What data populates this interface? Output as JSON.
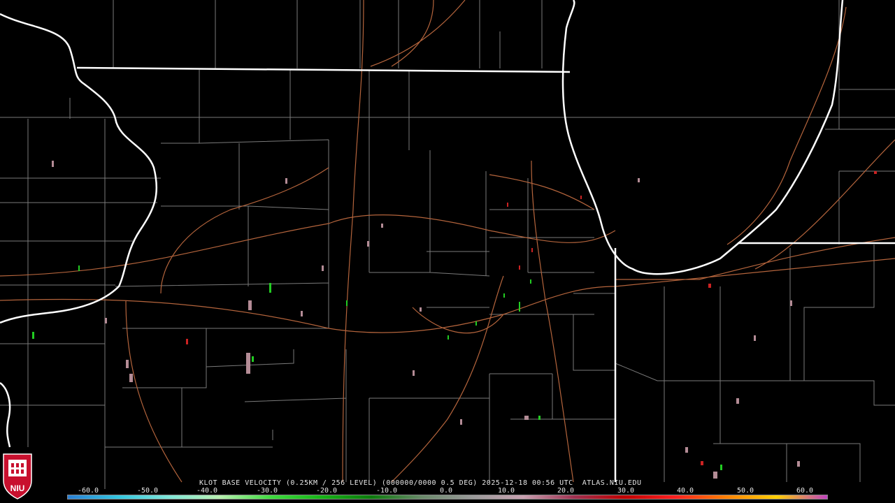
{
  "caption": {
    "product": "KLOT BASE VELOCITY (0.25KM / 256 LEVEL) (000000/0000 0.5 DEG) 2025-12-18 00:56 UTC  ATLAS.NIU.EDU"
  },
  "logo": {
    "text": "NIU",
    "color": "#c8102e"
  },
  "scale": {
    "labels": [
      "-60.0",
      "-50.0",
      "-40.0",
      "-30.0",
      "-20.0",
      "-10.0",
      "0.0",
      "10.0",
      "20.0",
      "30.0",
      "40.0",
      "50.0",
      "60.0"
    ],
    "gradient": [
      "#2a7fd4",
      "#33c6e0",
      "#7fe6d8",
      "#b8f0b0",
      "#3fdc3f",
      "#16b416",
      "#0b7a0b",
      "#6a8a6a",
      "#9a9a9a",
      "#c8a0b0",
      "#a03050",
      "#c00000",
      "#ff2020",
      "#ff8000",
      "#ffd000",
      "#c040c0"
    ]
  },
  "colors": {
    "border": "#ffffff",
    "county": "#8c8c8c",
    "road": "#b4643c",
    "echo_inbound": "#22cc22",
    "echo_outbound": "#cc2222",
    "echo_neutral": "#b48c96"
  }
}
